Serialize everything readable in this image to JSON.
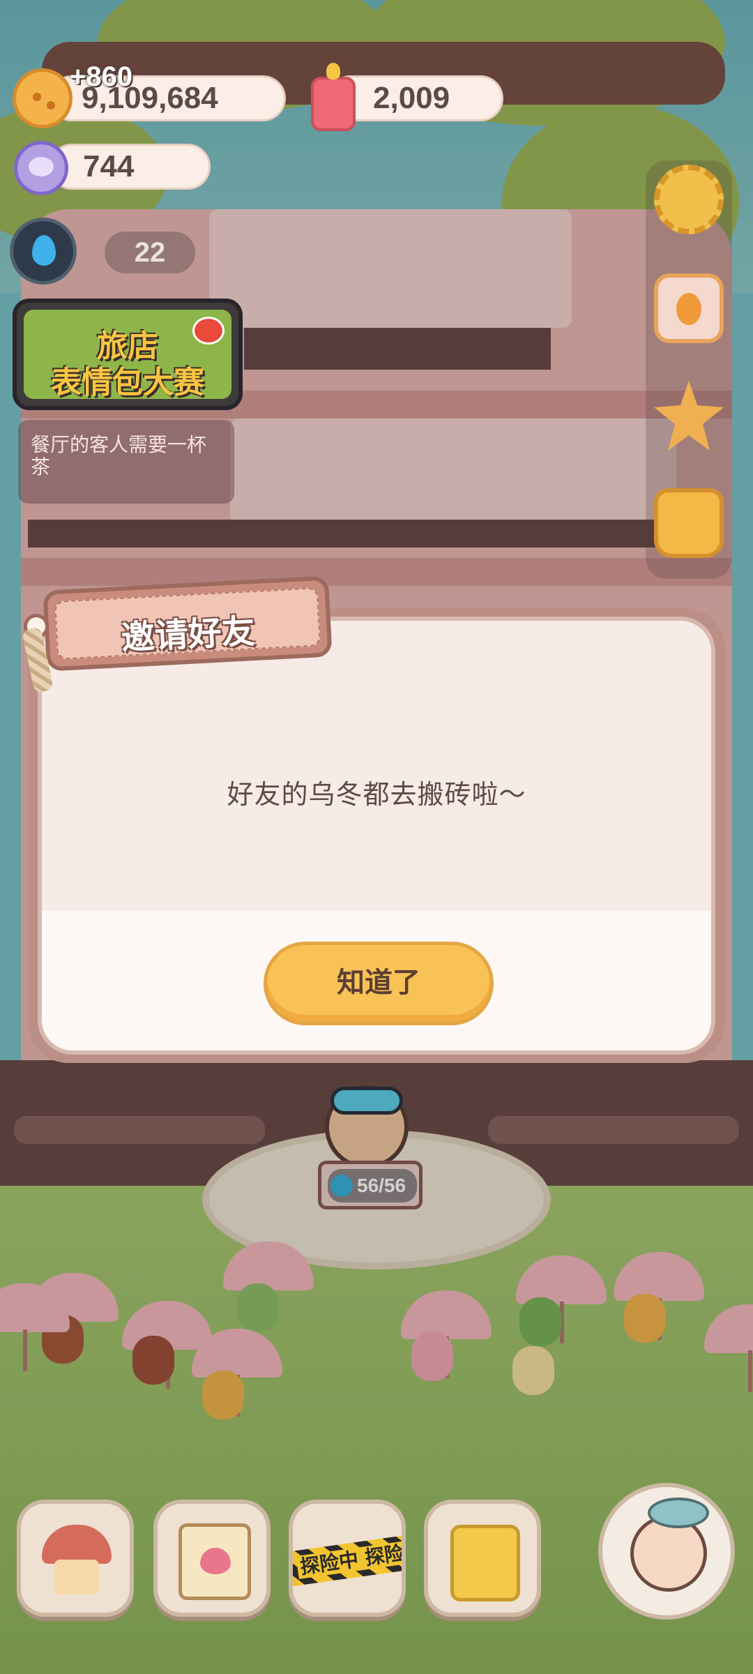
{
  "hud": {
    "coins": {
      "icon": "cookie-coin-icon",
      "value": "9,109,684",
      "gain": "+860"
    },
    "candles": {
      "icon": "candle-icon",
      "value": "2,009"
    },
    "gems": {
      "icon": "gem-icon",
      "value": "744"
    },
    "water": {
      "icon": "water-drop-icon"
    },
    "guest_count": "22"
  },
  "event_banner": {
    "line1": "旅店",
    "line2": "表情包大赛",
    "icon": "weibo-icon"
  },
  "task_tip": "餐厅的客人需要一杯茶",
  "side_menu": {
    "items": [
      {
        "icon": "gear-icon"
      },
      {
        "icon": "postcard-icon"
      },
      {
        "icon": "medal-icon"
      },
      {
        "icon": "backpack-icon"
      }
    ]
  },
  "dialog": {
    "title": "邀请好友",
    "message": "好友的乌冬都去搬砖啦～",
    "confirm_label": "知道了"
  },
  "counter": {
    "stamina": "56/56"
  },
  "bottom_nav": {
    "items": [
      {
        "icon": "mushroom-house-icon"
      },
      {
        "icon": "notebook-heart-icon"
      },
      {
        "icon": "exploring-tape-icon",
        "label": "探险中 探险"
      },
      {
        "icon": "shop-bag-icon"
      },
      {
        "icon": "fish-character-icon"
      }
    ]
  },
  "colors": {
    "dialog_bg": "#f6ebe6",
    "button": "#f8c257",
    "tag": "#c98c7c",
    "text": "#5c4a45"
  }
}
